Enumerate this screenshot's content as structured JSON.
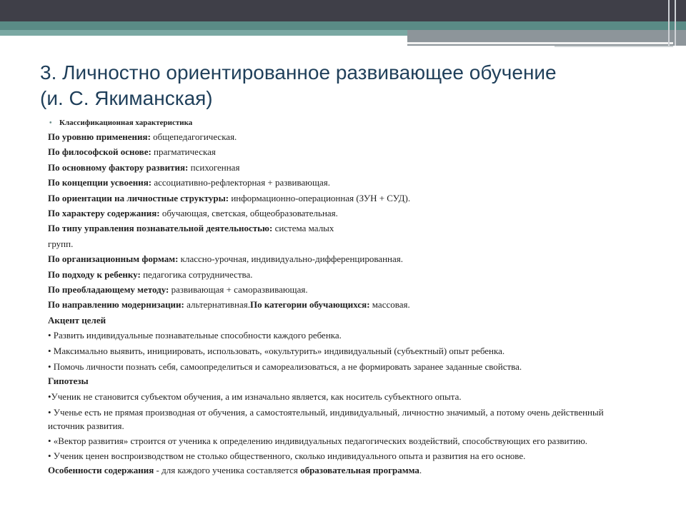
{
  "title_line1": "3. Личностно ориентированное развивающее обучение",
  "title_line2": "(и. С. Якиманская)",
  "bullet_heading": "Классификационная характеристика",
  "rows": [
    {
      "label": "По уровню применения:",
      "value": " общепедагогическая."
    },
    {
      "label": "По философской основе:",
      "value": " прагматическая"
    },
    {
      "label": "По основному фактору развития:",
      "value": " психогенная"
    },
    {
      "label": "По концепции усвоения:",
      "value": " ассоциативно-рефлекторная + развивающая."
    },
    {
      "label": "По ориентации на личностные структуры:",
      "value": " информационно-операционная (ЗУН + СУД)."
    },
    {
      "label": "По характеру содержания:",
      "value": " обучающая, светская, общеобразовательная."
    },
    {
      "label": "По типу управления познавательной деятельностью:",
      "value": " система малых"
    }
  ],
  "row_cont": "групп.",
  "rows2": [
    {
      "label": "По организационным формам:",
      "value": " классно-урочная, индивидуально-дифференцированная."
    },
    {
      "label": "По подходу к ребенку:",
      "value": " педагогика сотрудничества."
    },
    {
      "label": "По преобладающему методу:",
      "value": " развивающая + саморазвивающая."
    }
  ],
  "modern": {
    "label": "По направлению модернизации:",
    "value": " альтернативная.",
    "label2": "По категории обучающихся:",
    "value2": " массовая."
  },
  "goals_heading": "Акцент целей",
  "goals": [
    "• Развить индивидуальные познавательные способности каждого ребенка.",
    "• Максимально выявить, инициировать, использовать, «окультурить» индивидуальный (субъектный) опыт ребенка.",
    "• Помочь личности познать себя, самоопределиться и самореализоваться, а не формировать заранее заданные свойства."
  ],
  "hyp_heading": "Гипотезы",
  "hypotheses": [
    "•Ученик не становится субъектом обучения, а им изначально является, как носитель субъектного опыта.",
    "• Ученье есть не прямая производная от обучения, а самостоятельный, индивидуальный, личностно значимый, а потому очень действенный источник развития.",
    "• «Вектор развития» строится от ученика к определению индивидуальных педагогических воздействий, способствующих его развитию.",
    "• Ученик ценен воспроизводством не столько общественного, сколько индивидуального опыта и развития на его основе."
  ],
  "features": {
    "label": "Особенности содержания",
    "value": " - для каждого ученика составляется ",
    "label2": "образовательная программа",
    "value2": "."
  }
}
